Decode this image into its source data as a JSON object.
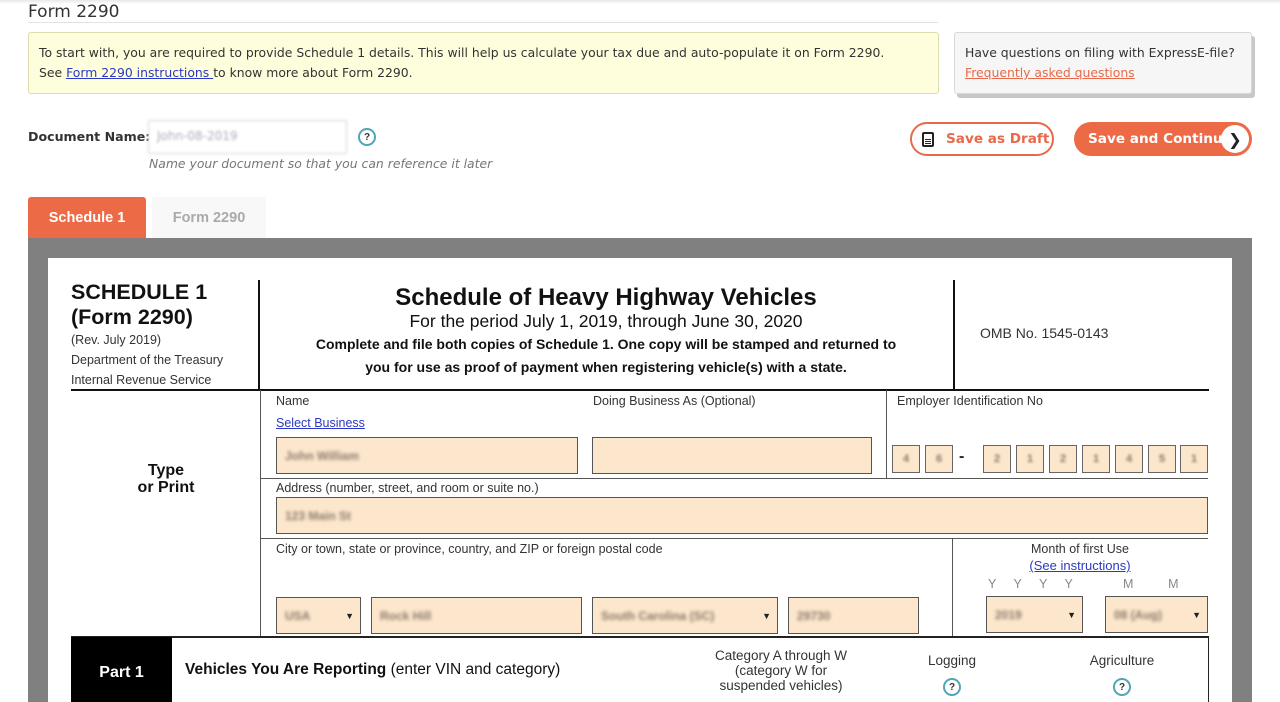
{
  "page": {
    "title": "Form 2290"
  },
  "info_box": {
    "text_line1": "To start with, you are required to provide Schedule 1 details. This will help us calculate your tax due and auto-populate it on Form 2290.",
    "text_prefix": "See ",
    "link_label": "Form 2290 instructions ",
    "text_suffix": "to know more about Form 2290."
  },
  "faq_box": {
    "question": "Have questions on filing with ExpressE-file?",
    "link_label": "Frequently asked questions"
  },
  "document": {
    "label": "Document Name:",
    "value": "John-08-2019",
    "hint": "Name your document so that you can reference it later",
    "help_glyph": "?"
  },
  "actions": {
    "save_draft_label": "Save as Draft",
    "save_continue_label": "Save and Continue",
    "continue_arrow": "❯"
  },
  "tabs": [
    {
      "label": "Schedule 1",
      "active": true
    },
    {
      "label": "Form 2290",
      "active": false
    }
  ],
  "schedule": {
    "form_id_line1": "SCHEDULE 1",
    "form_id_line2": "(Form 2290)",
    "revision": "(Rev. July 2019)",
    "department": "Department of the Treasury",
    "agency": "Internal Revenue Service",
    "title": "Schedule of Heavy Highway Vehicles",
    "period": "For the period July 1, 2019, through June 30, 2020",
    "note_line1": "Complete and file both copies of Schedule 1. One copy will be stamped and returned to",
    "note_line2": "you for use as proof of payment when registering vehicle(s) with a state.",
    "omb": "OMB No. 1545-0143",
    "type_or_print_line1": "Type",
    "type_or_print_line2": "or Print"
  },
  "fields": {
    "name_label": "Name",
    "select_business_label": "Select Business",
    "name_value": "John William",
    "dba_label": "Doing Business As (Optional)",
    "dba_value": "",
    "ein_label": "Employer Identification No",
    "ein_digits": [
      "4",
      "6",
      "2",
      "1",
      "2",
      "1",
      "4",
      "5",
      "1"
    ],
    "ein_separator": "-",
    "address_label": "Address (number, street, and room or suite no.)",
    "address_value": "123 Main St",
    "city_label": "City or town, state or province, country, and ZIP or foreign postal code",
    "country_value": "USA",
    "city_value": "Rock Hill",
    "state_value": "South Carolina (SC)",
    "zip_value": "29730",
    "month_first_use_label": "Month of first Use",
    "see_instructions_label": "(See instructions)",
    "year_placeholder": [
      "Y",
      "Y",
      "Y",
      "Y"
    ],
    "month_placeholder": [
      "M",
      "M"
    ],
    "year_value": "2019",
    "month_value": "08 (Aug)",
    "dropdown_glyph": "▼"
  },
  "part1": {
    "label": "Part 1",
    "title_bold": "Vehicles You Are Reporting",
    "title_rest": " (enter VIN and category)",
    "category_header": [
      "Category A through W",
      "(category W for",
      "suspended vehicles)"
    ],
    "logging_header": "Logging",
    "agriculture_header": "Agriculture",
    "help_glyph": "?"
  }
}
